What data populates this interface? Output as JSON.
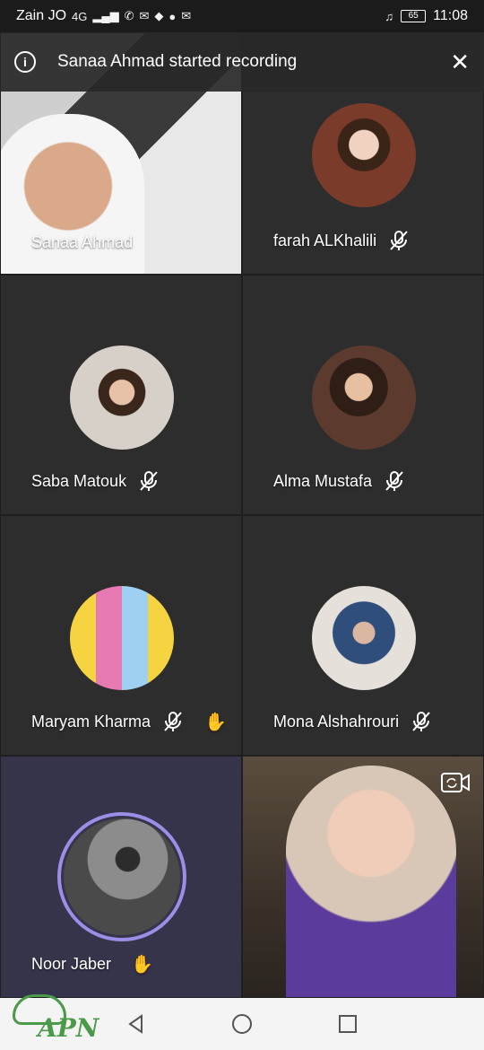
{
  "status_bar": {
    "carrier": "Zain JO",
    "network": "4G",
    "battery": "65",
    "time": "11:08"
  },
  "banner": {
    "text": "Sanaa Ahmad started recording"
  },
  "participants": [
    {
      "name": "Sanaa Ahmad",
      "muted": false,
      "hand_raised": false,
      "video": true
    },
    {
      "name": "farah ALKhalili",
      "muted": true,
      "hand_raised": false,
      "video": false
    },
    {
      "name": "Saba Matouk",
      "muted": true,
      "hand_raised": false,
      "video": false
    },
    {
      "name": "Alma Mustafa",
      "muted": true,
      "hand_raised": false,
      "video": false
    },
    {
      "name": "Maryam Kharma",
      "muted": true,
      "hand_raised": true,
      "video": false
    },
    {
      "name": "Mona Alshahrouri",
      "muted": true,
      "hand_raised": false,
      "video": false
    },
    {
      "name": "Noor Jaber",
      "muted": false,
      "hand_raised": true,
      "video": false
    },
    {
      "name": "",
      "muted": false,
      "hand_raised": false,
      "video": true
    }
  ],
  "watermark": "APN",
  "colors": {
    "accent": "#9b8ee6",
    "hand": "#f2b21b",
    "tile": "#2d2d2d",
    "tile_active": "#35344a"
  }
}
